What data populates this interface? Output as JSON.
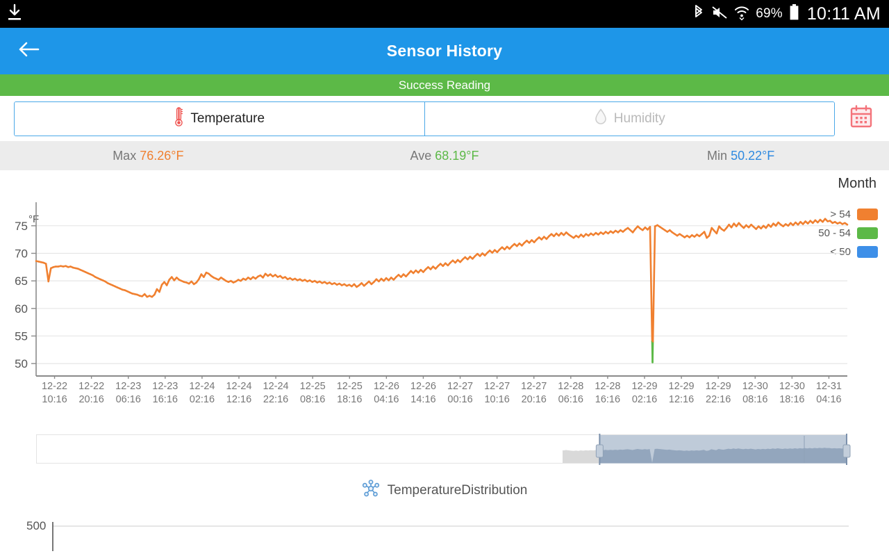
{
  "statusbar": {
    "download_icon": "download-icon",
    "bluetooth_icon": "bluetooth-icon",
    "mute_icon": "volume-mute-icon",
    "wifi_icon": "wifi-icon",
    "battery_pct": "69%",
    "battery_icon": "battery-icon",
    "time": "10:11 AM"
  },
  "appbar": {
    "back_icon": "back-arrow-icon",
    "title": "Sensor History"
  },
  "banner": {
    "text": "Success Reading"
  },
  "tabs": {
    "temperature": {
      "label": "Temperature",
      "icon": "thermometer-icon",
      "active": true
    },
    "humidity": {
      "label": "Humidity",
      "icon": "water-drop-icon",
      "active": false
    },
    "calendar": {
      "icon": "calendar-icon"
    }
  },
  "stats": {
    "max_label": "Max",
    "max_value": "76.26°F",
    "max_color": "#f08030",
    "ave_label": "Ave",
    "ave_value": "68.19°F",
    "ave_color": "#5cb947",
    "min_label": "Min",
    "min_value": "50.22°F",
    "min_color": "#2f8ae0"
  },
  "chart_data": {
    "type": "line",
    "title": "",
    "range_label": "Month",
    "xlabel": "",
    "ylabel": "°F",
    "ylim": [
      48.5,
      77.5
    ],
    "yticks": [
      50,
      55,
      60,
      65,
      70,
      75
    ],
    "grid": true,
    "legend_position": "top-right",
    "legend": [
      {
        "label": "> 54",
        "color": "#f08030"
      },
      {
        "label": "50 - 54",
        "color": "#5cb947"
      },
      {
        "label": "< 50",
        "color": "#3d8fe8"
      }
    ],
    "tick_labels": [
      {
        "date": "12-22",
        "time": "10:16"
      },
      {
        "date": "12-22",
        "time": "20:16"
      },
      {
        "date": "12-23",
        "time": "06:16"
      },
      {
        "date": "12-23",
        "time": "16:16"
      },
      {
        "date": "12-24",
        "time": "02:16"
      },
      {
        "date": "12-24",
        "time": "12:16"
      },
      {
        "date": "12-24",
        "time": "22:16"
      },
      {
        "date": "12-25",
        "time": "08:16"
      },
      {
        "date": "12-25",
        "time": "18:16"
      },
      {
        "date": "12-26",
        "time": "04:16"
      },
      {
        "date": "12-26",
        "time": "14:16"
      },
      {
        "date": "12-27",
        "time": "00:16"
      },
      {
        "date": "12-27",
        "time": "10:16"
      },
      {
        "date": "12-27",
        "time": "20:16"
      },
      {
        "date": "12-28",
        "time": "06:16"
      },
      {
        "date": "12-28",
        "time": "16:16"
      },
      {
        "date": "12-29",
        "time": "02:16"
      },
      {
        "date": "12-29",
        "time": "12:16"
      },
      {
        "date": "12-29",
        "time": "22:16"
      },
      {
        "date": "12-30",
        "time": "08:16"
      },
      {
        "date": "12-30",
        "time": "18:16"
      },
      {
        "date": "12-31",
        "time": "04:16"
      }
    ],
    "series": [
      {
        "name": "Temperature",
        "color": "#f08030",
        "values": [
          68.6,
          68.5,
          68.4,
          68.3,
          68.1,
          64.9,
          67.3,
          67.5,
          67.6,
          67.6,
          67.7,
          67.6,
          67.7,
          67.5,
          67.6,
          67.4,
          67.3,
          67.2,
          67.0,
          66.8,
          66.6,
          66.4,
          66.2,
          66.0,
          65.7,
          65.5,
          65.3,
          65.1,
          64.9,
          64.6,
          64.4,
          64.2,
          64.0,
          63.8,
          63.6,
          63.4,
          63.3,
          63.1,
          62.9,
          62.7,
          62.6,
          62.5,
          62.3,
          62.2,
          62.6,
          62.1,
          62.3,
          62.1,
          62.5,
          63.5,
          63.0,
          64.3,
          64.8,
          64.2,
          65.2,
          65.7,
          65.1,
          65.6,
          65.2,
          65.0,
          64.8,
          64.7,
          64.5,
          64.9,
          64.4,
          64.7,
          65.3,
          66.2,
          65.7,
          66.5,
          66.3,
          65.9,
          65.6,
          65.4,
          65.2,
          65.6,
          65.3,
          65.0,
          64.8,
          65.0,
          64.7,
          64.9,
          65.2,
          65.0,
          65.4,
          65.2,
          65.6,
          65.3,
          65.7,
          65.4,
          65.8,
          66.0,
          65.6,
          66.3,
          65.9,
          66.2,
          65.8,
          66.1,
          65.7,
          65.9,
          65.5,
          65.7,
          65.3,
          65.5,
          65.2,
          65.4,
          65.1,
          65.3,
          65.0,
          65.2,
          64.9,
          65.1,
          64.8,
          65.0,
          64.7,
          64.9,
          64.6,
          64.8,
          64.5,
          64.7,
          64.4,
          64.6,
          64.3,
          64.5,
          64.2,
          64.4,
          64.1,
          64.3,
          64.0,
          64.4,
          63.9,
          64.2,
          64.6,
          64.1,
          64.5,
          64.9,
          64.4,
          64.8,
          65.3,
          64.9,
          65.4,
          65.0,
          65.5,
          65.1,
          65.6,
          65.2,
          65.7,
          66.1,
          65.7,
          66.2,
          65.8,
          66.3,
          66.8,
          66.4,
          66.9,
          66.5,
          67.0,
          66.6,
          67.1,
          67.5,
          67.1,
          67.6,
          67.2,
          67.7,
          68.1,
          67.7,
          68.2,
          67.8,
          68.3,
          68.7,
          68.3,
          68.8,
          68.4,
          68.9,
          69.3,
          68.9,
          69.4,
          69.0,
          69.5,
          69.9,
          69.5,
          70.0,
          69.6,
          70.1,
          70.5,
          70.1,
          70.6,
          70.2,
          70.7,
          71.1,
          70.7,
          71.2,
          70.8,
          71.3,
          71.7,
          71.3,
          71.8,
          71.4,
          71.9,
          72.3,
          71.9,
          72.4,
          72.0,
          72.5,
          72.9,
          72.5,
          73.0,
          72.6,
          73.1,
          73.5,
          73.1,
          73.6,
          73.2,
          73.7,
          73.3,
          73.8,
          73.4,
          73.1,
          72.8,
          73.2,
          72.9,
          73.4,
          73.0,
          73.5,
          73.2,
          73.6,
          73.3,
          73.7,
          73.4,
          73.8,
          73.5,
          73.9,
          73.6,
          74.0,
          73.7,
          74.1,
          73.8,
          74.2,
          73.9,
          74.3,
          74.6,
          74.2,
          73.8,
          74.4,
          74.9,
          74.5,
          74.2,
          74.7,
          74.3,
          74.8,
          50.22,
          74.9,
          75.1,
          74.8,
          74.5,
          74.2,
          73.9,
          74.2,
          73.8,
          73.5,
          73.2,
          73.5,
          73.2,
          72.9,
          73.2,
          72.9,
          73.3,
          73.0,
          73.4,
          73.1,
          73.5,
          73.9,
          72.8,
          73.2,
          74.6,
          74.1,
          73.6,
          74.9,
          74.4,
          74.1,
          74.6,
          75.2,
          74.7,
          75.4,
          74.9,
          75.5,
          75.0,
          74.6,
          75.1,
          74.7,
          75.2,
          74.8,
          74.4,
          74.9,
          74.5,
          75.0,
          74.6,
          75.2,
          74.8,
          75.4,
          75.0,
          75.6,
          75.2,
          74.9,
          75.3,
          75.0,
          75.5,
          75.1,
          75.6,
          75.2,
          75.7,
          75.3,
          75.8,
          75.4,
          75.9,
          75.5,
          76.0,
          75.6,
          76.1,
          75.7,
          76.26,
          75.8,
          75.9,
          75.5,
          75.7,
          75.4,
          75.6,
          75.3,
          75.5,
          75.2
        ]
      }
    ]
  },
  "range_selector": {
    "name": "range-selector",
    "selection_start_pct": 69.5,
    "selection_end_pct": 100
  },
  "distribution": {
    "icon": "hub-nodes-icon",
    "title": "TemperatureDistribution",
    "ytick": "500"
  }
}
